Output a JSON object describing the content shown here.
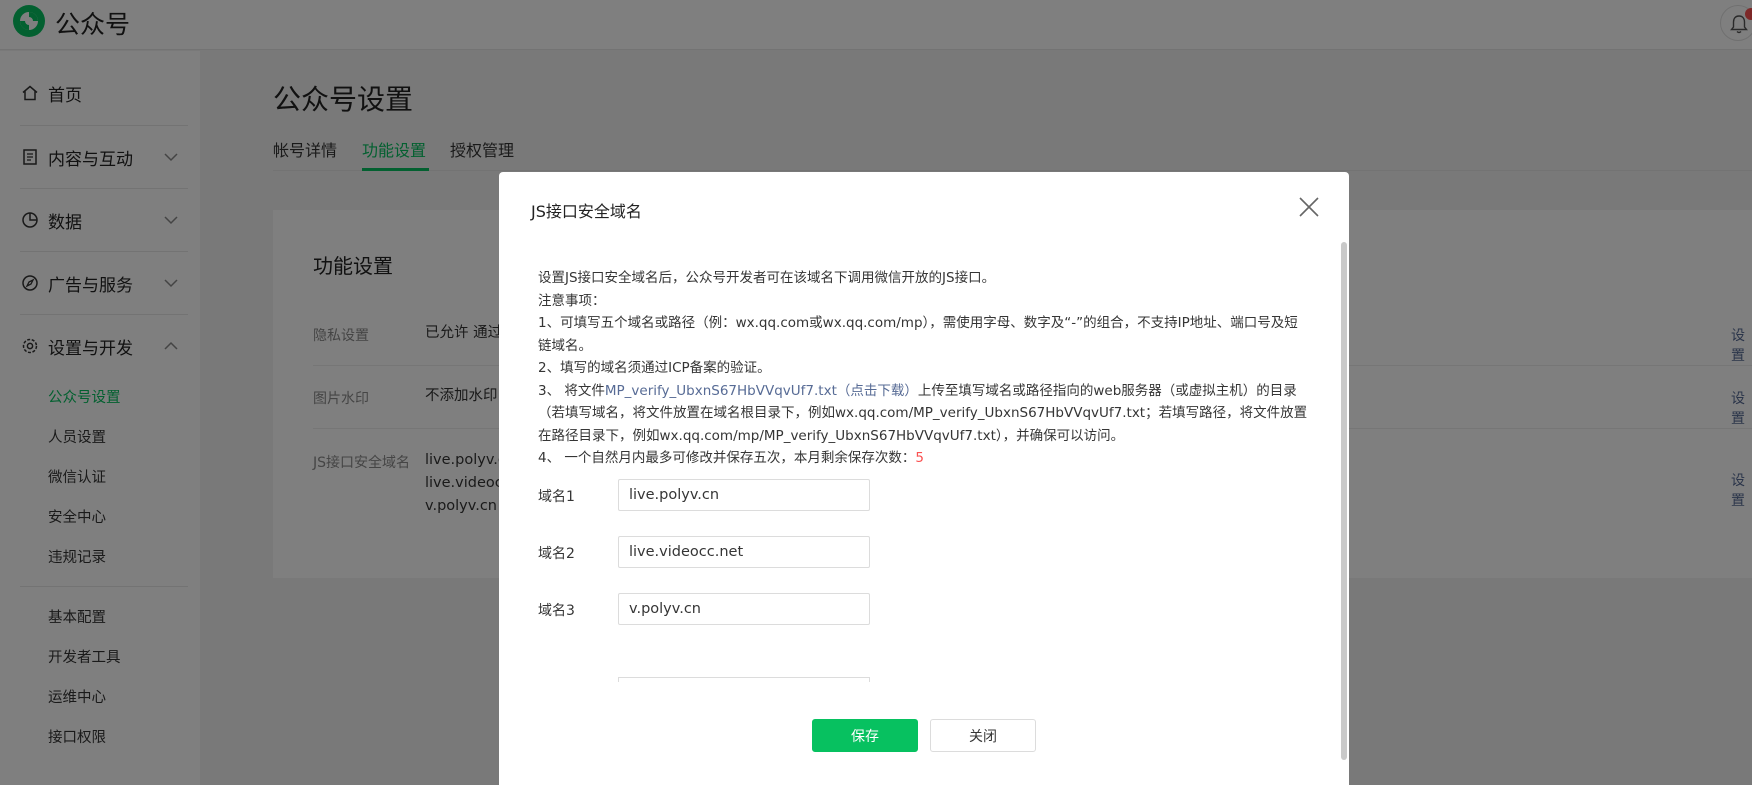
{
  "app": {
    "brand": "公众号"
  },
  "sidebar": {
    "items": [
      {
        "label": "首页",
        "icon": "home-icon"
      },
      {
        "label": "内容与互动",
        "icon": "document-icon"
      },
      {
        "label": "数据",
        "icon": "pie-chart-icon"
      },
      {
        "label": "广告与服务",
        "icon": "compass-icon"
      },
      {
        "label": "设置与开发",
        "icon": "gear-icon"
      }
    ],
    "sub_items": [
      {
        "label": "公众号设置",
        "active": true
      },
      {
        "label": "人员设置"
      },
      {
        "label": "微信认证"
      },
      {
        "label": "安全中心"
      },
      {
        "label": "违规记录"
      },
      {
        "label": "基本配置"
      },
      {
        "label": "开发者工具"
      },
      {
        "label": "运维中心"
      },
      {
        "label": "接口权限"
      }
    ]
  },
  "main": {
    "title": "公众号设置",
    "tabs": [
      {
        "label": "帐号详情"
      },
      {
        "label": "功能设置",
        "active": true
      },
      {
        "label": "授权管理"
      }
    ],
    "card": {
      "title": "功能设置",
      "rows": [
        {
          "label": "隐私设置",
          "value": "已允许 通过",
          "action": "设置"
        },
        {
          "label": "图片水印",
          "value": "不添加水印",
          "action": "设置"
        },
        {
          "label": "JS接口安全域名",
          "values": [
            "live.polyv.c",
            "live.videocc",
            "v.polyv.cn"
          ],
          "action": "设置"
        }
      ]
    }
  },
  "dialog": {
    "title": "JS接口安全域名",
    "intro": "设置JS接口安全域名后，公众号开发者可在该域名下调用微信开放的JS接口。",
    "notice_title": "注意事项：",
    "note1": "1、可填写五个域名或路径（例：wx.qq.com或wx.qq.com/mp），需使用字母、数字及“-”的组合，不支持IP地址、端口号及短链域名。",
    "note2": "2、填写的域名须通过ICP备案的验证。",
    "note3_prefix": "3、 将文件",
    "note3_link": "MP_verify_UbxnS67HbVVqvUf7.txt（点击下载）",
    "note3_suffix": "上传至填写域名或路径指向的web服务器（或虚拟主机）的目录（若填写域名，将文件放置在域名根目录下，例如wx.qq.com/MP_verify_UbxnS67HbVVqvUf7.txt；若填写路径，将文件放置在路径目录下，例如wx.qq.com/mp/MP_verify_UbxnS67HbVVqvUf7.txt），并确保可以访问。",
    "note4_prefix": "4、 一个自然月内最多可修改并保存五次，本月剩余保存次数：",
    "note4_count": "5",
    "fields": [
      {
        "label": "域名1",
        "value": "live.polyv.cn"
      },
      {
        "label": "域名2",
        "value": "live.videocc.net"
      },
      {
        "label": "域名3",
        "value": "v.polyv.cn"
      }
    ],
    "save_label": "保存",
    "close_label": "关闭"
  },
  "colors": {
    "accent": "#07c160",
    "link": "#576b95",
    "danger": "#fa5151"
  }
}
